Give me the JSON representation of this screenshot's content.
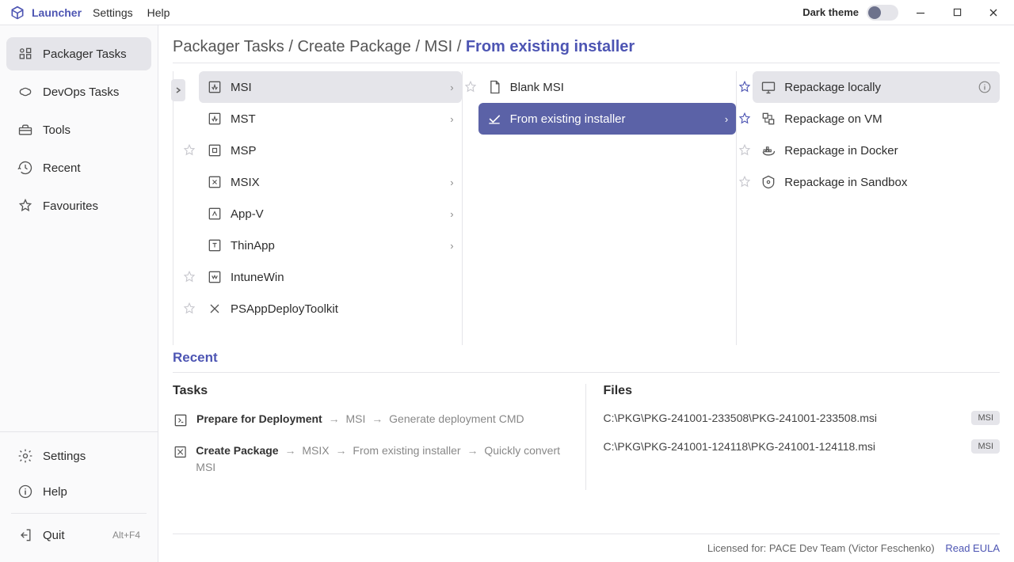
{
  "titlebar": {
    "app_name": "Launcher",
    "menu": [
      "Settings",
      "Help"
    ],
    "dark_theme_label": "Dark theme"
  },
  "sidebar": {
    "items": [
      {
        "label": "Packager Tasks"
      },
      {
        "label": "DevOps Tasks"
      },
      {
        "label": "Tools"
      },
      {
        "label": "Recent"
      },
      {
        "label": "Favourites"
      }
    ],
    "bottom": [
      {
        "label": "Settings"
      },
      {
        "label": "Help"
      }
    ],
    "quit_label": "Quit",
    "quit_shortcut": "Alt+F4"
  },
  "breadcrumb": {
    "parts": [
      "Packager Tasks",
      "Create Package",
      "MSI"
    ],
    "current": "From existing installer"
  },
  "col1": [
    {
      "label": "MSI",
      "chevron": true
    },
    {
      "label": "MST",
      "chevron": true
    },
    {
      "label": "MSP",
      "chevron": false
    },
    {
      "label": "MSIX",
      "chevron": true
    },
    {
      "label": "App-V",
      "chevron": true
    },
    {
      "label": "ThinApp",
      "chevron": true
    },
    {
      "label": "IntuneWin",
      "chevron": false
    },
    {
      "label": "PSAppDeployToolkit",
      "chevron": false
    }
  ],
  "col2": [
    {
      "label": "Blank MSI"
    },
    {
      "label": "From existing installer"
    }
  ],
  "col3": [
    {
      "label": "Repackage locally"
    },
    {
      "label": "Repackage on VM"
    },
    {
      "label": "Repackage in Docker"
    },
    {
      "label": "Repackage in Sandbox"
    }
  ],
  "recent": {
    "header": "Recent",
    "tasks_title": "Tasks",
    "files_title": "Files",
    "tasks": [
      {
        "bold": "Prepare for Deployment",
        "path": [
          "MSI",
          "Generate deployment CMD"
        ]
      },
      {
        "bold": "Create Package",
        "path": [
          "MSIX",
          "From existing installer",
          "Quickly convert MSI"
        ]
      }
    ],
    "files": [
      {
        "path": "C:\\PKG\\PKG-241001-233508\\PKG-241001-233508.msi",
        "badge": "MSI"
      },
      {
        "path": "C:\\PKG\\PKG-241001-124118\\PKG-241001-124118.msi",
        "badge": "MSI"
      }
    ]
  },
  "footer": {
    "license": "Licensed for: PACE Dev Team (Victor Feschenko)",
    "eula": "Read EULA"
  }
}
